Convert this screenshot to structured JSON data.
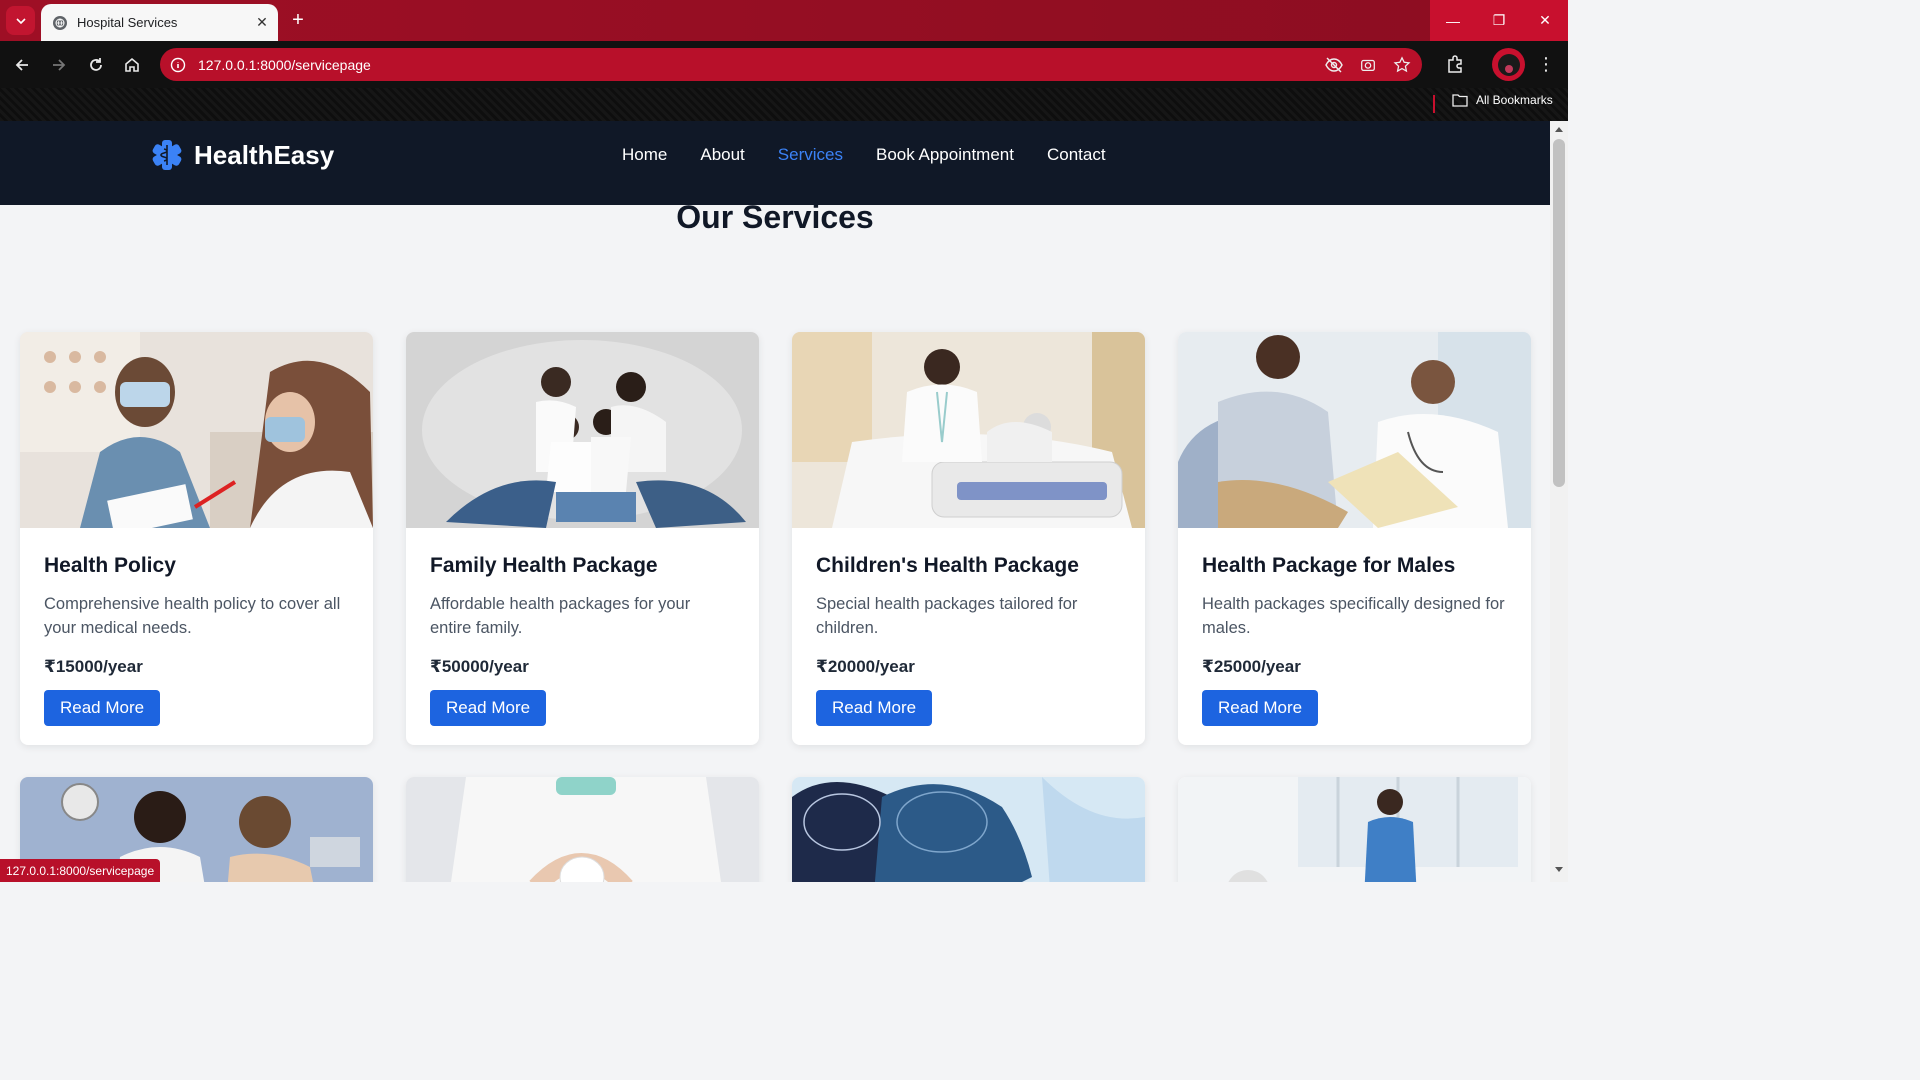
{
  "browser": {
    "tab_title": "Hospital Services",
    "url": "127.0.0.1:8000/servicepage",
    "bookmarks_label": "All Bookmarks",
    "status_url": "127.0.0.1:8000/servicepage",
    "accent_color": "#b8102a"
  },
  "site": {
    "brand": "HealthEasy",
    "nav": [
      {
        "label": "Home"
      },
      {
        "label": "About"
      },
      {
        "label": "Services"
      },
      {
        "label": "Book Appointment"
      },
      {
        "label": "Contact"
      }
    ],
    "active_nav": "Services",
    "section_title": "Our Services"
  },
  "services": [
    {
      "title": "Health Policy",
      "description": "Comprehensive health policy to cover all your medical needs.",
      "price": "₹15000/year",
      "button": "Read More"
    },
    {
      "title": "Family Health Package",
      "description": "Affordable health packages for your entire family.",
      "price": "₹50000/year",
      "button": "Read More"
    },
    {
      "title": "Children's Health Package",
      "description": "Special health packages tailored for children.",
      "price": "₹20000/year",
      "button": "Read More"
    },
    {
      "title": "Health Package for Males",
      "description": "Health packages specifically designed for males.",
      "price": "₹25000/year",
      "button": "Read More"
    }
  ],
  "colors": {
    "navbar": "#101827",
    "nav_active": "#3b82f6",
    "button": "#1d64e0"
  }
}
